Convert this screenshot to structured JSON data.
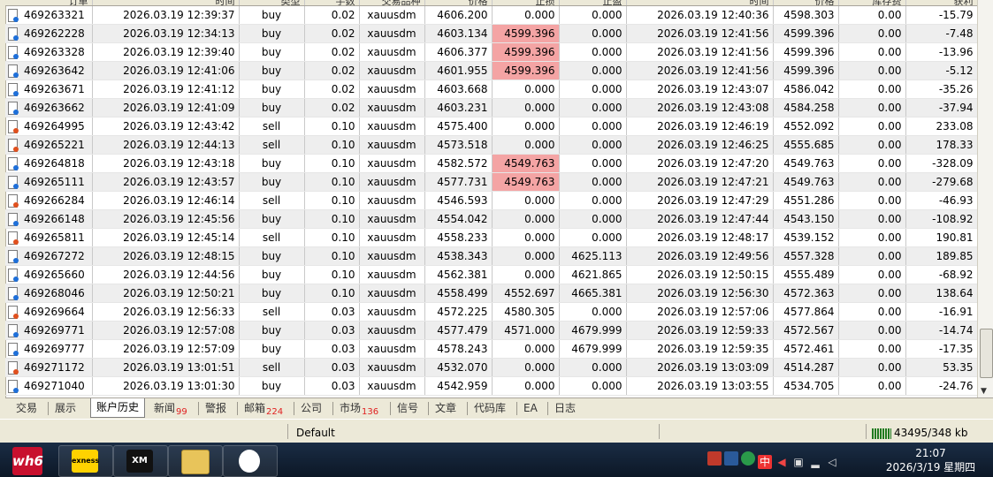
{
  "columns": [
    "订单",
    "时间",
    "类型",
    "手数",
    "交易品种",
    "价格",
    "止损",
    "止盈",
    "时间",
    "价格",
    "库存费",
    "获利"
  ],
  "rows": [
    {
      "type": "buy",
      "cells": [
        "469263321",
        "2026.03.19 12:39:37",
        "buy",
        "0.02",
        "xauusdm",
        "4606.200",
        "0.000",
        "0.000",
        "2026.03.19 12:40:36",
        "4598.303",
        "0.00",
        "-15.79"
      ],
      "red_sl": false
    },
    {
      "type": "buy",
      "cells": [
        "469262228",
        "2026.03.19 12:34:13",
        "buy",
        "0.02",
        "xauusdm",
        "4603.134",
        "4599.396",
        "0.000",
        "2026.03.19 12:41:56",
        "4599.396",
        "0.00",
        "-7.48"
      ],
      "red_sl": true
    },
    {
      "type": "buy",
      "cells": [
        "469263328",
        "2026.03.19 12:39:40",
        "buy",
        "0.02",
        "xauusdm",
        "4606.377",
        "4599.396",
        "0.000",
        "2026.03.19 12:41:56",
        "4599.396",
        "0.00",
        "-13.96"
      ],
      "red_sl": true
    },
    {
      "type": "buy",
      "cells": [
        "469263642",
        "2026.03.19 12:41:06",
        "buy",
        "0.02",
        "xauusdm",
        "4601.955",
        "4599.396",
        "0.000",
        "2026.03.19 12:41:56",
        "4599.396",
        "0.00",
        "-5.12"
      ],
      "red_sl": true
    },
    {
      "type": "buy",
      "cells": [
        "469263671",
        "2026.03.19 12:41:12",
        "buy",
        "0.02",
        "xauusdm",
        "4603.668",
        "0.000",
        "0.000",
        "2026.03.19 12:43:07",
        "4586.042",
        "0.00",
        "-35.26"
      ],
      "red_sl": false
    },
    {
      "type": "buy",
      "cells": [
        "469263662",
        "2026.03.19 12:41:09",
        "buy",
        "0.02",
        "xauusdm",
        "4603.231",
        "0.000",
        "0.000",
        "2026.03.19 12:43:08",
        "4584.258",
        "0.00",
        "-37.94"
      ],
      "red_sl": false
    },
    {
      "type": "sell",
      "cells": [
        "469264995",
        "2026.03.19 12:43:42",
        "sell",
        "0.10",
        "xauusdm",
        "4575.400",
        "0.000",
        "0.000",
        "2026.03.19 12:46:19",
        "4552.092",
        "0.00",
        "233.08"
      ],
      "red_sl": false
    },
    {
      "type": "sell",
      "cells": [
        "469265221",
        "2026.03.19 12:44:13",
        "sell",
        "0.10",
        "xauusdm",
        "4573.518",
        "0.000",
        "0.000",
        "2026.03.19 12:46:25",
        "4555.685",
        "0.00",
        "178.33"
      ],
      "red_sl": false
    },
    {
      "type": "buy",
      "cells": [
        "469264818",
        "2026.03.19 12:43:18",
        "buy",
        "0.10",
        "xauusdm",
        "4582.572",
        "4549.763",
        "0.000",
        "2026.03.19 12:47:20",
        "4549.763",
        "0.00",
        "-328.09"
      ],
      "red_sl": true
    },
    {
      "type": "buy",
      "cells": [
        "469265111",
        "2026.03.19 12:43:57",
        "buy",
        "0.10",
        "xauusdm",
        "4577.731",
        "4549.763",
        "0.000",
        "2026.03.19 12:47:21",
        "4549.763",
        "0.00",
        "-279.68"
      ],
      "red_sl": true
    },
    {
      "type": "sell",
      "cells": [
        "469266284",
        "2026.03.19 12:46:14",
        "sell",
        "0.10",
        "xauusdm",
        "4546.593",
        "0.000",
        "0.000",
        "2026.03.19 12:47:29",
        "4551.286",
        "0.00",
        "-46.93"
      ],
      "red_sl": false
    },
    {
      "type": "buy",
      "cells": [
        "469266148",
        "2026.03.19 12:45:56",
        "buy",
        "0.10",
        "xauusdm",
        "4554.042",
        "0.000",
        "0.000",
        "2026.03.19 12:47:44",
        "4543.150",
        "0.00",
        "-108.92"
      ],
      "red_sl": false
    },
    {
      "type": "sell",
      "cells": [
        "469265811",
        "2026.03.19 12:45:14",
        "sell",
        "0.10",
        "xauusdm",
        "4558.233",
        "0.000",
        "0.000",
        "2026.03.19 12:48:17",
        "4539.152",
        "0.00",
        "190.81"
      ],
      "red_sl": false
    },
    {
      "type": "buy",
      "cells": [
        "469267272",
        "2026.03.19 12:48:15",
        "buy",
        "0.10",
        "xauusdm",
        "4538.343",
        "0.000",
        "4625.113",
        "2026.03.19 12:49:56",
        "4557.328",
        "0.00",
        "189.85"
      ],
      "red_sl": false
    },
    {
      "type": "buy",
      "cells": [
        "469265660",
        "2026.03.19 12:44:56",
        "buy",
        "0.10",
        "xauusdm",
        "4562.381",
        "0.000",
        "4621.865",
        "2026.03.19 12:50:15",
        "4555.489",
        "0.00",
        "-68.92"
      ],
      "red_sl": false
    },
    {
      "type": "buy",
      "cells": [
        "469268046",
        "2026.03.19 12:50:21",
        "buy",
        "0.10",
        "xauusdm",
        "4558.499",
        "4552.697",
        "4665.381",
        "2026.03.19 12:56:30",
        "4572.363",
        "0.00",
        "138.64"
      ],
      "red_sl": false
    },
    {
      "type": "sell",
      "cells": [
        "469269664",
        "2026.03.19 12:56:33",
        "sell",
        "0.03",
        "xauusdm",
        "4572.225",
        "4580.305",
        "0.000",
        "2026.03.19 12:57:06",
        "4577.864",
        "0.00",
        "-16.91"
      ],
      "red_sl": false
    },
    {
      "type": "buy",
      "cells": [
        "469269771",
        "2026.03.19 12:57:08",
        "buy",
        "0.03",
        "xauusdm",
        "4577.479",
        "4571.000",
        "4679.999",
        "2026.03.19 12:59:33",
        "4572.567",
        "0.00",
        "-14.74"
      ],
      "red_sl": false
    },
    {
      "type": "buy",
      "cells": [
        "469269777",
        "2026.03.19 12:57:09",
        "buy",
        "0.03",
        "xauusdm",
        "4578.243",
        "0.000",
        "4679.999",
        "2026.03.19 12:59:35",
        "4572.461",
        "0.00",
        "-17.35"
      ],
      "red_sl": false
    },
    {
      "type": "sell",
      "cells": [
        "469271172",
        "2026.03.19 13:01:51",
        "sell",
        "0.03",
        "xauusdm",
        "4532.070",
        "0.000",
        "0.000",
        "2026.03.19 13:03:09",
        "4514.287",
        "0.00",
        "53.35"
      ],
      "red_sl": false
    },
    {
      "type": "buy",
      "cells": [
        "469271040",
        "2026.03.19 13:01:30",
        "buy",
        "0.03",
        "xauusdm",
        "4542.959",
        "0.000",
        "0.000",
        "2026.03.19 13:03:55",
        "4534.705",
        "0.00",
        "-24.76"
      ],
      "red_sl": false
    }
  ],
  "tabs": [
    {
      "label": "交易",
      "badge": ""
    },
    {
      "label": "展示",
      "badge": ""
    },
    {
      "label": "账户历史",
      "badge": "",
      "active": true
    },
    {
      "label": "新闻",
      "badge": "99"
    },
    {
      "label": "警报",
      "badge": ""
    },
    {
      "label": "邮箱",
      "badge": "224"
    },
    {
      "label": "公司",
      "badge": ""
    },
    {
      "label": "市场",
      "badge": "136"
    },
    {
      "label": "信号",
      "badge": ""
    },
    {
      "label": "文章",
      "badge": ""
    },
    {
      "label": "代码库",
      "badge": ""
    },
    {
      "label": "EA",
      "badge": ""
    },
    {
      "label": "日志",
      "badge": ""
    }
  ],
  "status": {
    "profile": "Default",
    "traffic": "43495/348 kb"
  },
  "taskbar": {
    "start_label": "wh6",
    "apps": [
      {
        "name": "exness",
        "label": "exness",
        "color": "#ffd200"
      },
      {
        "name": "xm",
        "label": "XM",
        "color": "#000000"
      },
      {
        "name": "explorer",
        "label": "",
        "color": "#f0c040"
      },
      {
        "name": "qq",
        "label": "",
        "color": "#ffffff"
      }
    ]
  },
  "tray_icons": [
    "app-icon",
    "antivirus-icon",
    "browser-icon",
    "ime-icon",
    "volume-icon",
    "network-icon",
    "signal-icon",
    "speaker-icon"
  ],
  "clock": {
    "time": "21:07",
    "date": "2026/3/19 星期四"
  }
}
